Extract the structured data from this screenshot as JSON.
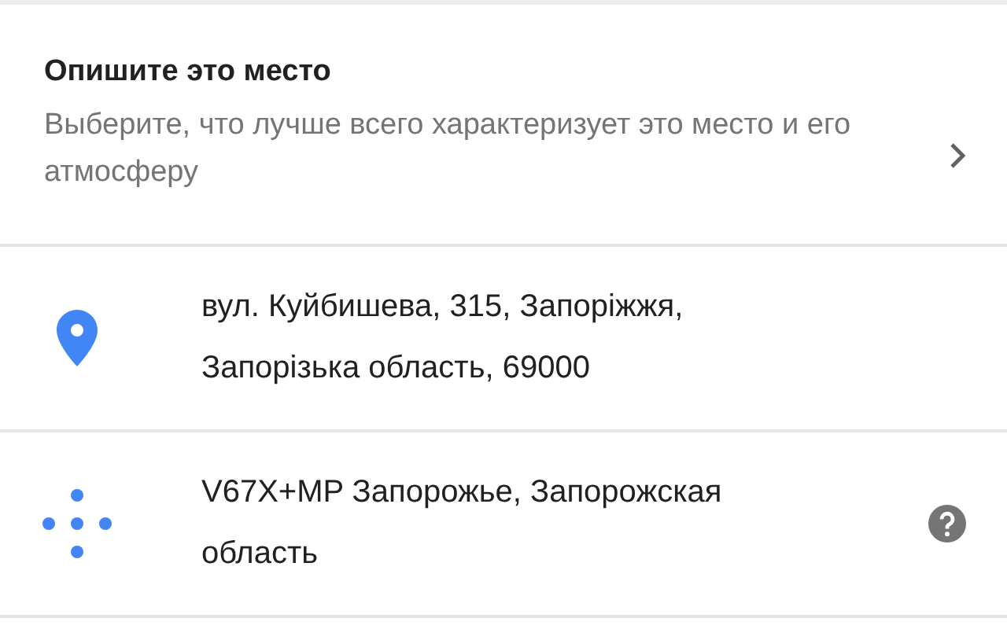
{
  "describe": {
    "title": "Опишите это место",
    "subtitle": "Выберите, что лучше всего характеризует это место и его атмосферу"
  },
  "rows": [
    {
      "kind": "address",
      "lines": [
        "вул. Куйбишева, 315, Запоріжжя,",
        "Запорізька область, 69000"
      ]
    },
    {
      "kind": "plus_code",
      "lines": [
        "V67X+MP Запорожье, Запорожская",
        "область"
      ]
    }
  ]
}
